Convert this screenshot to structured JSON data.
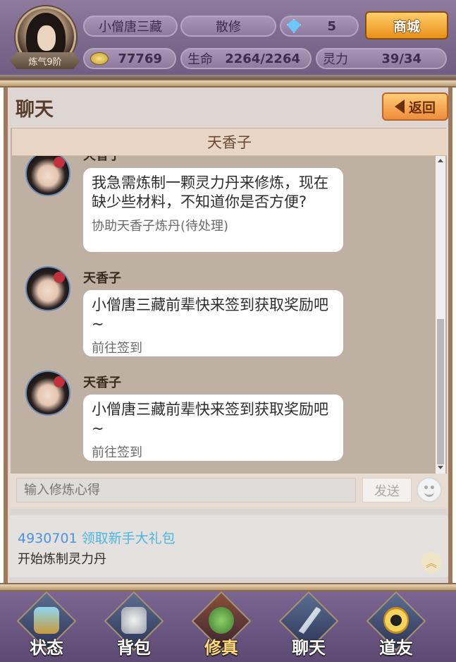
{
  "header": {
    "avatar_realm": "炼气9阶",
    "player_name": "小僧唐三藏",
    "sect": "散修",
    "gems": "5",
    "coins": "77769",
    "life_label": "生命",
    "life_value": "2264/2264",
    "spirit_label": "灵力",
    "spirit_value": "39/34",
    "mall_label": "商城"
  },
  "chat": {
    "title": "聊天",
    "back_label": "返回",
    "partner": "天香子",
    "messages": [
      {
        "sender": "天香子",
        "text": "我急需炼制一颗灵力丹来修炼，现在缺少些材料，不知道你是否方便?",
        "action": "协助天香子炼丹(待处理)"
      },
      {
        "sender": "天香子",
        "text": "小僧唐三藏前辈快来签到获取奖励吧~",
        "action": "前往签到"
      },
      {
        "sender": "天香子",
        "text": "小僧唐三藏前辈快来签到获取奖励吧~",
        "action": "前往签到"
      }
    ],
    "input_placeholder": "输入修炼心得",
    "send_label": "发送"
  },
  "notice": {
    "player_id": "4930701",
    "gift_link": "领取新手大礼包",
    "status": "开始炼制灵力丹"
  },
  "nav": {
    "items": [
      {
        "label": "状态",
        "icon": "potion-gourd-icon"
      },
      {
        "label": "背包",
        "icon": "bag-icon"
      },
      {
        "label": "修真",
        "icon": "frog-cultivation-icon"
      },
      {
        "label": "聊天",
        "icon": "feather-quill-icon"
      },
      {
        "label": "道友",
        "icon": "yin-yang-icon"
      }
    ],
    "active": "修真"
  }
}
